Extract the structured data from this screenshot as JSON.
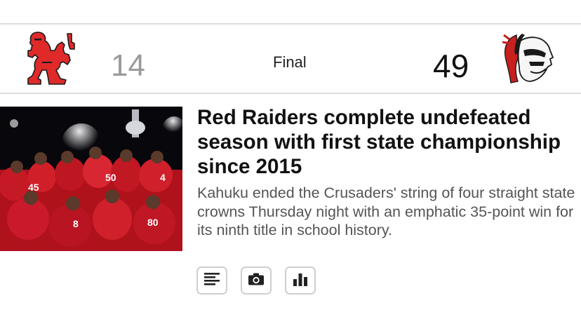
{
  "game": {
    "away": {
      "logo": "crusader-knight-logo",
      "score": "14"
    },
    "status": "Final",
    "home": {
      "logo": "red-raider-warrior-logo",
      "score": "49"
    }
  },
  "story": {
    "image": "team-celebration-photo",
    "headline": "Red Raiders complete undefeated season with first state championship since 2015",
    "summary": "Kahuku ended the Crusaders' string of four straight state crowns Thursday night with an emphatic 35-point win for its ninth title in school history."
  },
  "actions": [
    {
      "icon": "article-icon"
    },
    {
      "icon": "camera-icon"
    },
    {
      "icon": "bar-chart-icon"
    }
  ],
  "colors": {
    "crusader_red": "#e02a2a",
    "raider_red": "#c8201e",
    "muted_score": "#9a9a9a"
  }
}
